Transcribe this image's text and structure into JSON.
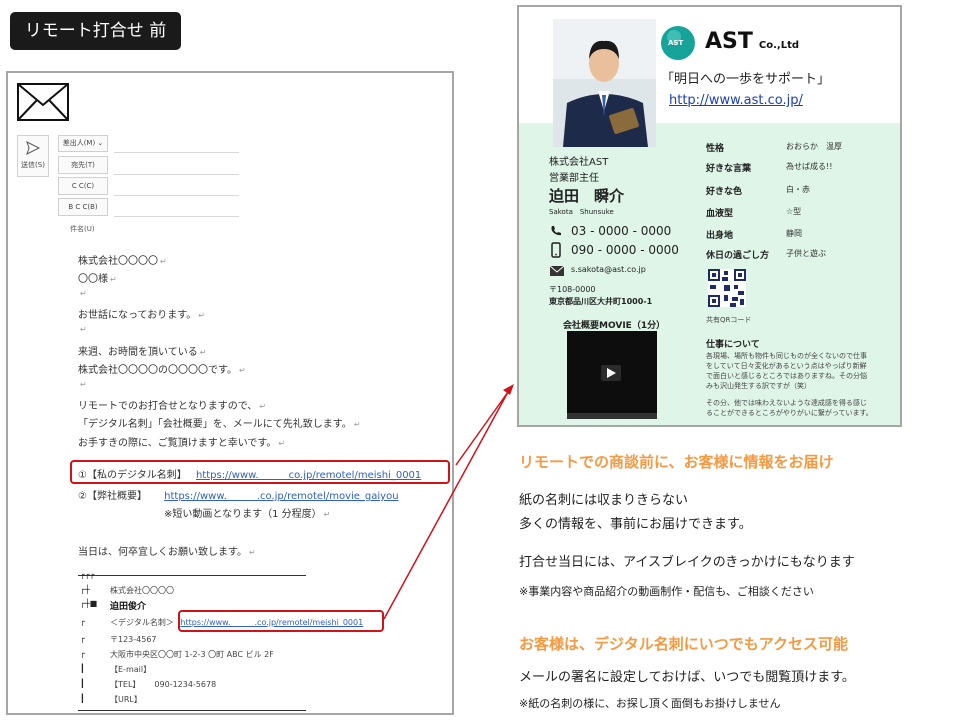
{
  "title_tag": "リモート打合せ 前",
  "email": {
    "send_label": "送信(S)",
    "from_label": "差出人(M) ⌄",
    "to_label": "宛先(T)",
    "cc_label": "C C(C)",
    "bcc_label": "B C C(B)",
    "subject_label": "件名(U)",
    "body_lines": [
      "株式会社〇〇〇〇",
      "〇〇様",
      "",
      "お世話になっております。",
      "",
      "来週、お時間を頂いている",
      "株式会社〇〇〇〇の〇〇〇〇です。",
      "",
      "リモートでのお打合せとなりますので、",
      "「デジタル名刺」「会社概要」を、メールにて先礼致します。",
      "お手すきの際に、ご覧頂けますと幸いです。"
    ],
    "link1_label": "①【私のデジタル名刺】",
    "link1_url": "https://www.　　　co.jp/remotel/meishi_0001",
    "link2_label": "②【弊社概要】",
    "link2_url": "https://www.　　　.co.jp/remotel/movie_gaiyou",
    "link2_note": "※短い動画となります（1 分程度）",
    "closing": "当日は、何卒宜しくお願い致します。",
    "signature": {
      "company": "株式会社〇〇〇〇",
      "name": "迫田俊介",
      "digital_label": "＜デジタル名刺＞",
      "digital_url": "https://www.　　　.co.jp/remotel/meishi_0001",
      "zip": "〒123-4567",
      "address": "大阪市中央区〇〇町 1-2-3 〇町 ABC ビル 2F",
      "email_label": "【E-mail】",
      "tel_label": "【TEL】",
      "tel": "090-1234-5678",
      "url_label": "【URL】"
    }
  },
  "card": {
    "logo_badge": "AST",
    "brand": "AST",
    "brand_suffix": "Co.,Ltd",
    "slogan": "「明日への一歩をサポート」",
    "url": "http://www.ast.co.jp/",
    "company": "株式会社AST",
    "role": "営業部主任",
    "name": "迫田　瞬介",
    "romaji": "Sakota　Shunsuke",
    "phone": "03 - 0000 - 0000",
    "mobile": "090 - 0000 - 0000",
    "email": "s.sakota@ast.co.jp",
    "zip": "〒108-0000",
    "address": "東京都品川区大井町1000-1",
    "movie_title": "会社概要MOVIE（1分）",
    "attributes": [
      {
        "label": "性格",
        "value": "おおらか　温厚"
      },
      {
        "label": "好きな言葉",
        "value": "為せば成る!!"
      },
      {
        "label": "好きな色",
        "value": "白・赤"
      },
      {
        "label": "血液型",
        "value": "☆型"
      },
      {
        "label": "出身地",
        "value": "静岡"
      },
      {
        "label": "休日の過ごし方",
        "value": "子供と遊ぶ"
      }
    ],
    "qr_label": "共有QRコード",
    "work_title": "仕事について",
    "work_text": [
      "各現場、場所も物件も同じものが全くないので仕事",
      "をしていて日々変化があるという点はやっぱり新鮮",
      "で面白いと感じるところではありますね。その分悩",
      "みも沢山発生する訳ですが（笑）",
      "その分、他では味わえないような達成感を得る感じ",
      "ることができるところがやりがいに繋がっています。"
    ]
  },
  "right": {
    "head1": "リモートでの商談前に、お客様に情報をお届け",
    "text1a": "紙の名刺には収まりきらない",
    "text1b": "多くの情報を、事前にお届けできます。",
    "text2": "打合せ当日には、アイスブレイクのきっかけにもなります",
    "note1": "※事業内容や商品紹介の動画制作・配信も、ご相談ください",
    "head2": "お客様は、デジタル名刺にいつでもアクセス可能",
    "text3": "メールの署名に設定しておけば、いつでも閲覧頂けます。",
    "note2": "※紙の名刺の様に、お探し頂く面倒もお掛けしません"
  },
  "colors": {
    "accent_red": "#d0121b",
    "accent_orange": "#f39a43",
    "mint": "#def5e8",
    "logo_teal": "#16a39a"
  }
}
